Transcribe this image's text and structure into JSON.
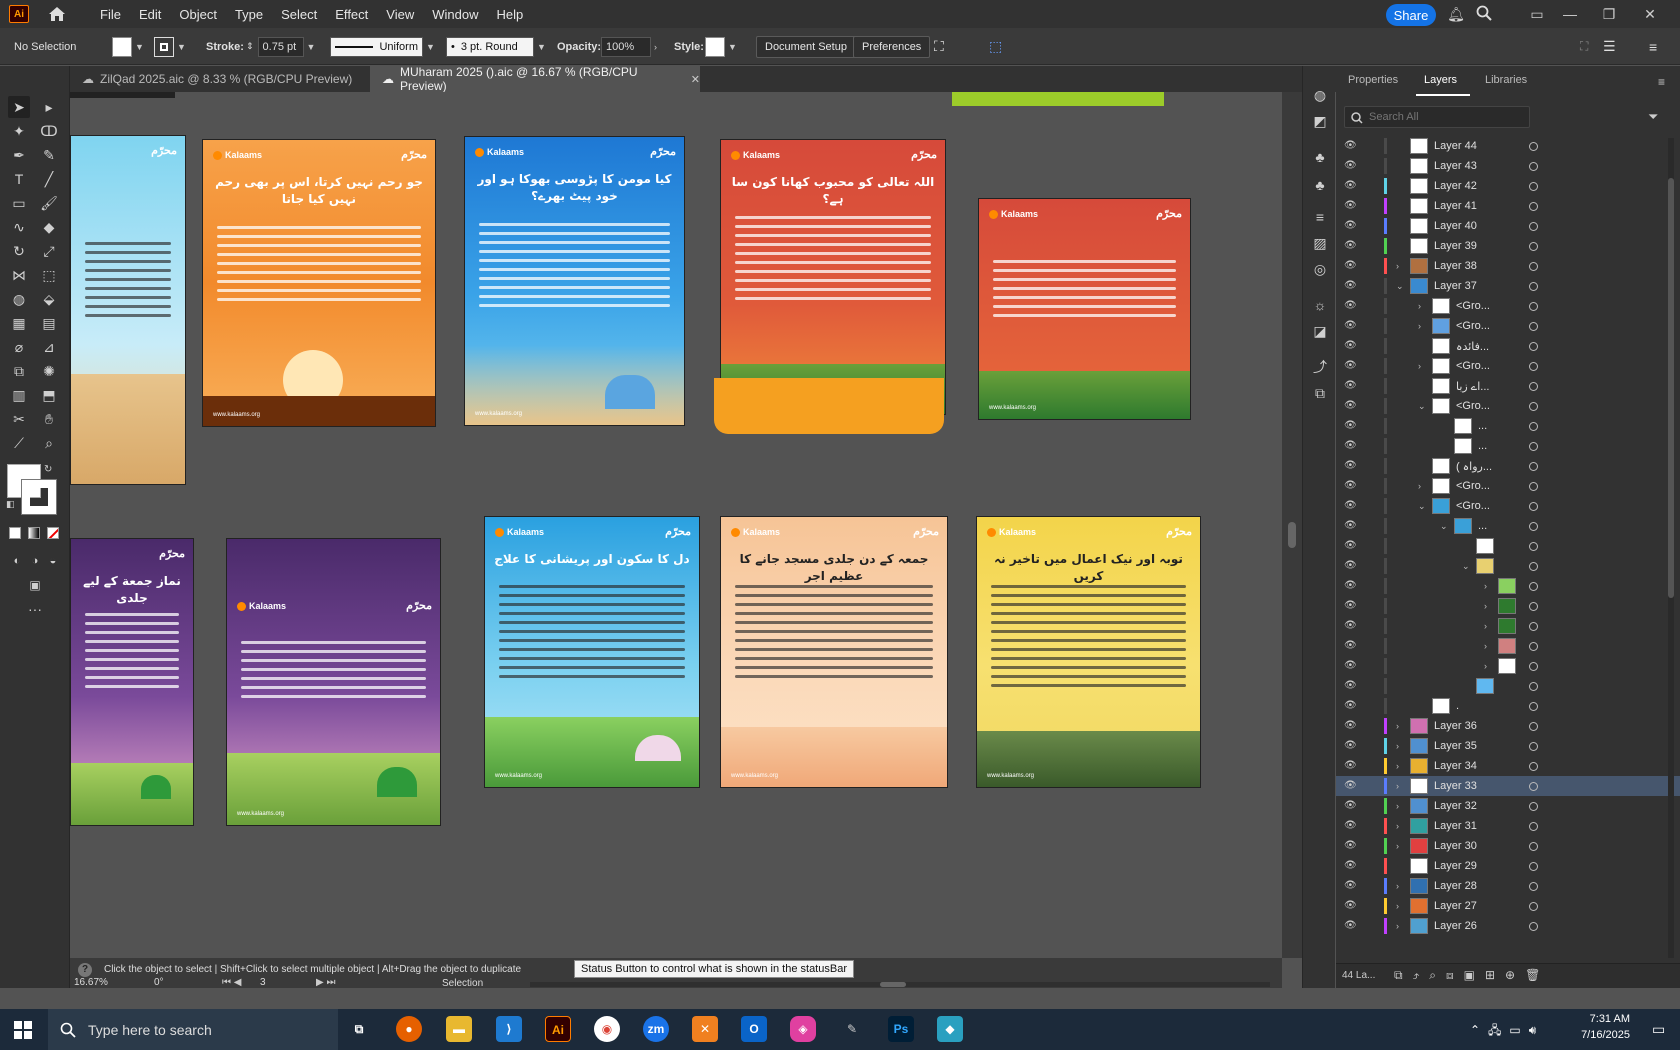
{
  "app": {
    "logo": "Ai"
  },
  "menu": [
    "File",
    "Edit",
    "Object",
    "Type",
    "Select",
    "Effect",
    "View",
    "Window",
    "Help"
  ],
  "share_label": "Share",
  "controlbar": {
    "selection": "No Selection",
    "stroke_label": "Stroke:",
    "stroke_value": "0.75 pt",
    "profile": "Uniform",
    "brush": "3 pt. Round",
    "opacity_label": "Opacity:",
    "opacity_value": "100%",
    "style_label": "Style:",
    "document_setup": "Document Setup",
    "preferences": "Preferences"
  },
  "tabs": [
    {
      "label": "ZilQad 2025.aic @ 8.33 % (RGB/CPU Preview)"
    },
    {
      "label": "MUharam 2025 ().aic @ 16.67 % (RGB/CPU Preview)"
    }
  ],
  "artboards": {
    "brand": "Kalaams",
    "badge": "محرّم",
    "a2_title": "جو رحم نہیں کرتا، اس پر بھی رحم نہیں کیا جاتا",
    "a3_title": "کیا مومن کا پڑوسی بھوکا ہو اور خود پیٹ بھرے؟",
    "a4_title": "اللہ تعالی کو محبوب کھانا کون سا ہے؟",
    "b1_title": "نماز جمعة کے لیے جلدی",
    "b3_title": "دل کا سکون اور پریشانی کا علاج",
    "b4_title": "جمعہ کے دن جلدی مسجد جانے کا عظیم اجر",
    "b5_title": "توبہ اور نیک اعمال میں تاخیر نہ کریں",
    "footer": "www.kalaams.org"
  },
  "panel": {
    "tabs": [
      "Properties",
      "Layers",
      "Libraries"
    ],
    "search_placeholder": "Search All",
    "footer_count": "44 La...",
    "rows": [
      {
        "name": "Layer 44",
        "color": "#4a4a4a",
        "thumb": "#ffffff",
        "chev": ""
      },
      {
        "name": "Layer 43",
        "color": "#4a4a4a",
        "thumb": "#ffffff",
        "chev": ""
      },
      {
        "name": "Layer 42",
        "color": "#5fd3e8",
        "thumb": "#ffffff",
        "chev": ""
      },
      {
        "name": "Layer 41",
        "color": "#c040ff",
        "thumb": "#ffffff",
        "chev": ""
      },
      {
        "name": "Layer 40",
        "color": "#5a7dff",
        "thumb": "#ffffff",
        "chev": ""
      },
      {
        "name": "Layer 39",
        "color": "#52d152",
        "thumb": "#ffffff",
        "chev": ""
      },
      {
        "name": "Layer 38",
        "color": "#ff5050",
        "thumb": "#b07040",
        "chev": "›"
      },
      {
        "name": "Layer 37",
        "color": "#4a4a4a",
        "thumb": "#3a8ad0",
        "chev": "⌄"
      },
      {
        "name": "<Gro...",
        "color": "#4a4a4a",
        "thumb": "#ffffff",
        "chev": "›",
        "indent": 1
      },
      {
        "name": "<Gro...",
        "color": "#4a4a4a",
        "thumb": "#60a0e0",
        "chev": "›",
        "indent": 1
      },
      {
        "name": "فائدہ...",
        "color": "#4a4a4a",
        "thumb": "#ffffff",
        "chev": "",
        "indent": 1
      },
      {
        "name": "<Gro...",
        "color": "#4a4a4a",
        "thumb": "#ffffff",
        "chev": "›",
        "indent": 1
      },
      {
        "name": "اے زبا...",
        "color": "#4a4a4a",
        "thumb": "#ffffff",
        "chev": "",
        "indent": 1
      },
      {
        "name": "<Gro...",
        "color": "#4a4a4a",
        "thumb": "#ffffff",
        "chev": "⌄",
        "indent": 1
      },
      {
        "name": "...",
        "color": "#4a4a4a",
        "thumb": "#ffffff",
        "chev": "",
        "indent": 2
      },
      {
        "name": "...",
        "color": "#4a4a4a",
        "thumb": "#ffffff",
        "chev": "",
        "indent": 2
      },
      {
        "name": "( رواہ...",
        "color": "#4a4a4a",
        "thumb": "#ffffff",
        "chev": "",
        "indent": 1
      },
      {
        "name": "<Gro...",
        "color": "#4a4a4a",
        "thumb": "#ffffff",
        "chev": "›",
        "indent": 1
      },
      {
        "name": "<Gro...",
        "color": "#4a4a4a",
        "thumb": "#3aa0d8",
        "chev": "⌄",
        "indent": 1
      },
      {
        "name": "...",
        "color": "#4a4a4a",
        "thumb": "#3aa0d8",
        "chev": "⌄",
        "indent": 2
      },
      {
        "name": "",
        "color": "#4a4a4a",
        "thumb": "#ffffff",
        "chev": "",
        "indent": 3
      },
      {
        "name": "",
        "color": "#4a4a4a",
        "thumb": "#e8d070",
        "chev": "⌄",
        "indent": 3
      },
      {
        "name": "",
        "color": "#4a4a4a",
        "thumb": "#8ad060",
        "chev": "›",
        "indent": 4
      },
      {
        "name": "",
        "color": "#4a4a4a",
        "thumb": "#2e7a2e",
        "chev": "›",
        "indent": 4
      },
      {
        "name": "",
        "color": "#4a4a4a",
        "thumb": "#2e7a2e",
        "chev": "›",
        "indent": 4
      },
      {
        "name": "",
        "color": "#4a4a4a",
        "thumb": "#d08080",
        "chev": "›",
        "indent": 4
      },
      {
        "name": "",
        "color": "#4a4a4a",
        "thumb": "#ffffff",
        "chev": "›",
        "indent": 4
      },
      {
        "name": "",
        "color": "#4a4a4a",
        "thumb": "#60b8f0",
        "chev": "",
        "indent": 3
      },
      {
        "name": ".",
        "color": "#4a4a4a",
        "thumb": "#ffffff",
        "chev": "",
        "indent": 1
      },
      {
        "name": "Layer 36",
        "color": "#c040ff",
        "thumb": "#d070b0",
        "chev": "›"
      },
      {
        "name": "Layer 35",
        "color": "#5fd3e8",
        "thumb": "#5090d0",
        "chev": "›"
      },
      {
        "name": "Layer 34",
        "color": "#ffcc30",
        "thumb": "#e8b030",
        "chev": "›"
      },
      {
        "name": "Layer 33",
        "color": "#5a7dff",
        "thumb": "#ffffff",
        "chev": "›",
        "selected": true
      },
      {
        "name": "Layer 32",
        "color": "#52d152",
        "thumb": "#5090d0",
        "chev": "›"
      },
      {
        "name": "Layer 31",
        "color": "#ff5050",
        "thumb": "#30a0a0",
        "chev": "›"
      },
      {
        "name": "Layer 30",
        "color": "#52d152",
        "thumb": "#e04040",
        "chev": "›"
      },
      {
        "name": "Layer 29",
        "color": "#ff5050",
        "thumb": "#ffffff",
        "chev": ""
      },
      {
        "name": "Layer 28",
        "color": "#5a7dff",
        "thumb": "#3070b0",
        "chev": "›"
      },
      {
        "name": "Layer 27",
        "color": "#ffcc30",
        "thumb": "#e07030",
        "chev": "›"
      },
      {
        "name": "Layer 26",
        "color": "#c040ff",
        "thumb": "#50a0d0",
        "chev": "›"
      }
    ]
  },
  "status": {
    "hint": "Click the object to select  |  Shift+Click to select multiple object  |  Alt+Drag the object to duplicate",
    "tooltip": "Status Button to control what is shown in the statusBar",
    "zoom": "16.67%",
    "rotation": "0°",
    "artboard": "3",
    "tool": "Selection"
  },
  "taskbar": {
    "search_placeholder": "Type here to search",
    "time": "7:31 AM",
    "date": "7/16/2025"
  }
}
